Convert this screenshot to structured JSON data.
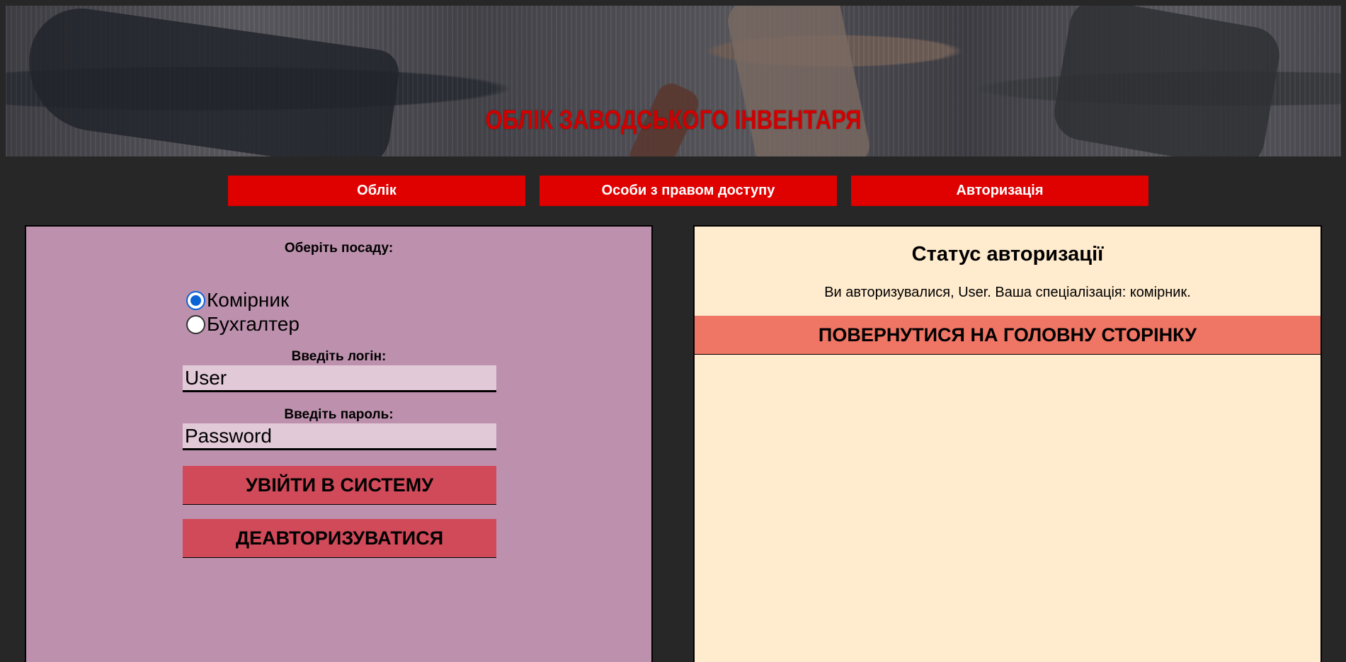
{
  "header": {
    "title": "ОБЛІК ЗАВОДСЬКОГО ІНВЕНТАРЯ"
  },
  "nav": {
    "items": [
      {
        "label": "Облік"
      },
      {
        "label": "Особи з правом доступу"
      },
      {
        "label": "Авторизація"
      }
    ]
  },
  "login_form": {
    "position_label": "Оберіть посаду:",
    "positions": [
      {
        "label": "Комірник",
        "checked": true
      },
      {
        "label": "Бухгалтер",
        "checked": false
      }
    ],
    "login_label": "Введіть логін:",
    "login_value": "User",
    "password_label": "Введіть пароль:",
    "password_value": "Password",
    "login_button": "УВІЙТИ В СИСТЕМУ",
    "logout_button": "ДЕАВТОРИЗУВАТИСЯ"
  },
  "status_panel": {
    "title": "Статус авторизації",
    "message": "Ви авторизувалися, User. Ваша спеціалізація: комірник.",
    "home_button": "ПОВЕРНУТИСЯ НА ГОЛОВНУ СТОРІНКУ"
  },
  "colors": {
    "page_bg": "#272727",
    "nav_red": "#df0000",
    "title_red": "#d00000",
    "left_panel": "#bd91ad",
    "right_panel": "#ffebcd",
    "action_button": "#d14a59",
    "home_button": "#ef7565",
    "radio_accent": "#0b63d6"
  }
}
